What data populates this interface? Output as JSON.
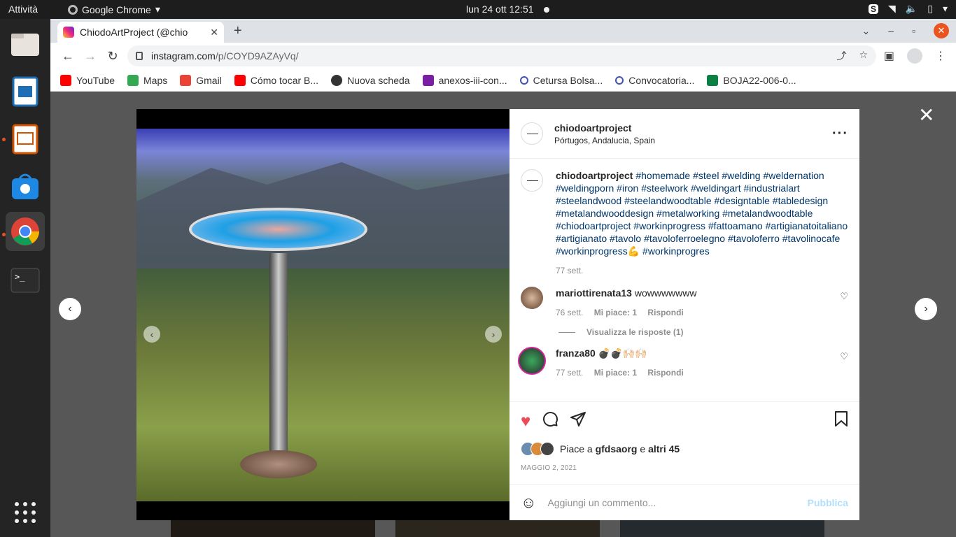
{
  "topbar": {
    "activities": "Attività",
    "app_name": "Google Chrome",
    "clock": "lun 24 ott  12:51"
  },
  "browser": {
    "tab_title": "ChiodoArtProject (@chio",
    "url_host": "instagram.com",
    "url_path": "/p/COYD9AZAyVq/",
    "bookmarks": [
      {
        "label": "YouTube",
        "color": "#ff0000"
      },
      {
        "label": "Maps",
        "color": "#34a853"
      },
      {
        "label": "Gmail",
        "color": "#ea4335"
      },
      {
        "label": "Cómo tocar B...",
        "color": "#ff0000"
      },
      {
        "label": "Nuova scheda",
        "color": "#333333"
      },
      {
        "label": "anexos-iii-con...",
        "color": "#7b1fa2"
      },
      {
        "label": "Cetursa Bolsa...",
        "color": "#3f51b5"
      },
      {
        "label": "Convocatoria...",
        "color": "#3f51b5"
      },
      {
        "label": "BOJA22-006-0...",
        "color": "#0b8043"
      }
    ]
  },
  "post": {
    "username": "chiodoartproject",
    "location": "Pórtugos, Andalucia, Spain",
    "caption_user": "chiodoartproject",
    "caption_tags": "#homemade #steel #welding #weldernation #weldingporn #iron #steelwork #weldingart #industrialart #steelandwood #steelandwoodtable #designtable #tabledesign #metalandwooddesign #metalworking #metalandwoodtable #chiodoartproject #workinprogress #fattoamano #artigianatoitaliano #artigianato #tavolo #tavoloferroelegno #tavoloferro #tavolinocafe #workinprogress💪 #workinprogres",
    "caption_age": "77 sett.",
    "comments": [
      {
        "user": "mariottirenata13",
        "text": "wowwwwwww",
        "age": "76 sett.",
        "likes": "Mi piace: 1",
        "reply": "Rispondi"
      },
      {
        "user": "franza80",
        "text": "💣💣🙌🏻🙌🏻",
        "age": "77 sett.",
        "likes": "Mi piace: 1",
        "reply": "Rispondi"
      }
    ],
    "view_replies": "Visualizza le risposte (1)",
    "likes_prefix": "Piace a ",
    "likes_user": "gfdsaorg",
    "likes_mid": " e ",
    "likes_others": "altri 45",
    "date": "MAGGIO 2, 2021",
    "comment_placeholder": "Aggiungi un commento...",
    "publish": "Pubblica"
  },
  "colors": {
    "accent_like": "#ed4956",
    "link": "#00376b",
    "ubuntu_orange": "#e95420"
  }
}
